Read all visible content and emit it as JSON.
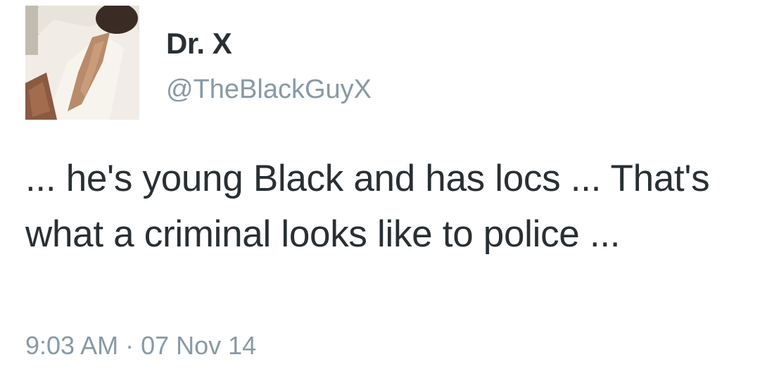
{
  "tweet": {
    "display_name": "Dr. X",
    "handle": "@TheBlackGuyX",
    "text": "... he's young Black and has locs ... That's what a criminal looks like to police ...",
    "timestamp": "9:03 AM · 07 Nov 14"
  },
  "avatar": {
    "icon": "profile-photo"
  },
  "colors": {
    "name": "#292f33",
    "secondary": "#8899a6",
    "background": "#ffffff"
  }
}
